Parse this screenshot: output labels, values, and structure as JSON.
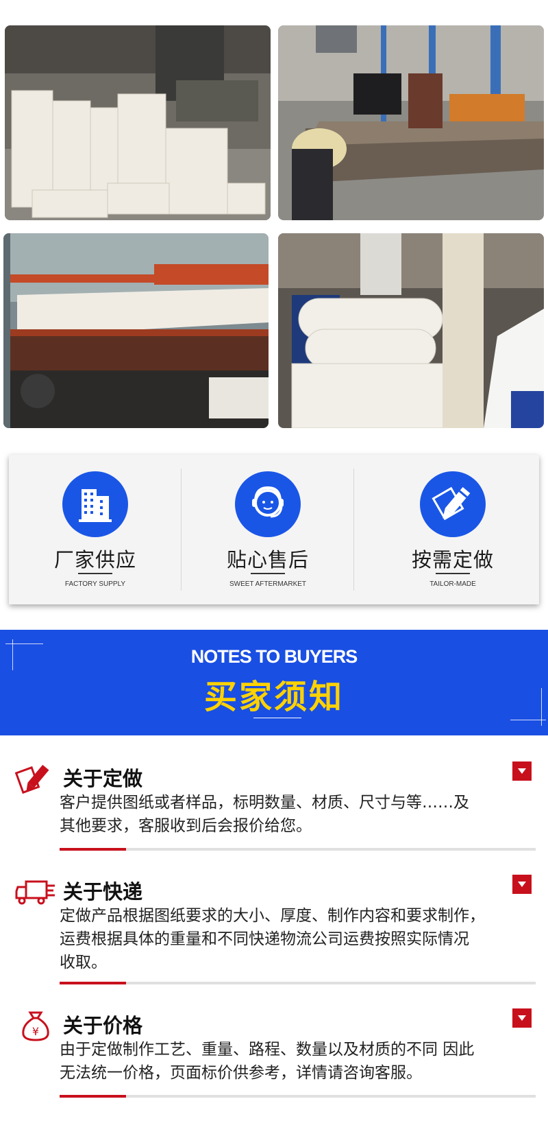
{
  "photos": [
    {
      "alt": "felt-stacks-photo"
    },
    {
      "alt": "workers-felt-table-photo"
    },
    {
      "alt": "felt-machine-photo"
    },
    {
      "alt": "felt-rolls-photo"
    }
  ],
  "features": [
    {
      "icon": "building-icon",
      "title": "厂家供应",
      "subtitle": "FACTORY SUPPLY"
    },
    {
      "icon": "customer-service-icon",
      "title": "贴心售后",
      "subtitle": "SWEET AFTERMARKET"
    },
    {
      "icon": "pencil-edit-icon",
      "title": "按需定做",
      "subtitle": "TAILOR-MADE"
    }
  ],
  "banner": {
    "title_en": "NOTES TO BUYERS",
    "title_zh": "买家须知"
  },
  "notes": [
    {
      "icon": "pen-edit-icon",
      "title": "关于定做",
      "lines": [
        "客户提供图纸或者样品，标明数量、材质、尺寸与等……及",
        "其他要求，客服收到后会报价给您。"
      ]
    },
    {
      "icon": "delivery-truck-icon",
      "title": "关于快递",
      "lines": [
        "定做产品根据图纸要求的大小、厚度、制作内容和要求制作，",
        "运费根据具体的重量和不同快递物流公司运费按照实际情况",
        "收取。"
      ]
    },
    {
      "icon": "money-bag-icon",
      "title": "关于价格",
      "lines": [
        "由于定做制作工艺、重量、路程、数量以及材质的不同 因此",
        "无法统一价格，页面标价供参考，详情请咨询客服。"
      ]
    }
  ],
  "colors": {
    "blue": "#1a4fe3",
    "red": "#c8101d",
    "yellow": "#ffd200"
  }
}
